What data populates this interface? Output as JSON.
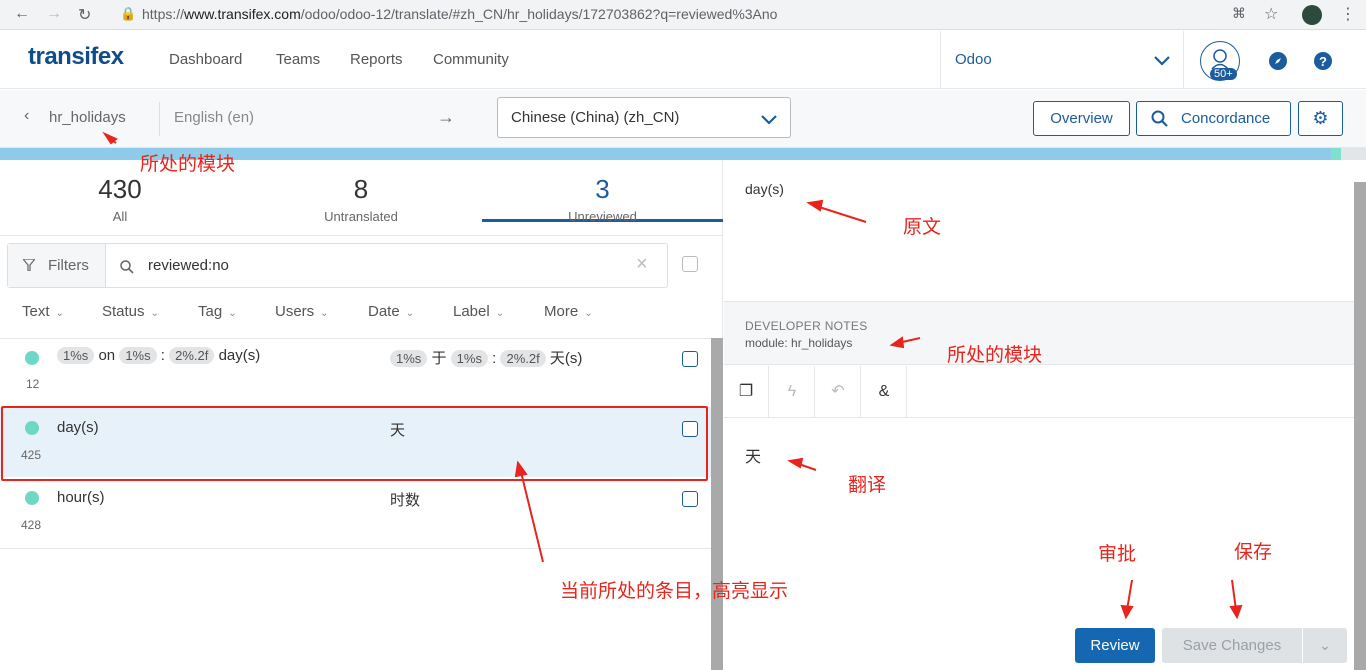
{
  "browser": {
    "url_prefix": "https://",
    "url_host": "www.transifex.com",
    "url_path": "/odoo/odoo-12/translate/#zh_CN/hr_holidays/172703862?q=reviewed%3Ano"
  },
  "topnav": {
    "logo": "transifex",
    "links": [
      "Dashboard",
      "Teams",
      "Reports",
      "Community"
    ],
    "org": "Odoo",
    "badge": "50+"
  },
  "subbar": {
    "resource": "hr_holidays",
    "source_lang": "English (en)",
    "arrow": "→",
    "target_lang": "Chinese (China) (zh_CN)",
    "overview": "Overview",
    "concordance": "Concordance"
  },
  "stats": [
    {
      "num": "430",
      "label": "All"
    },
    {
      "num": "8",
      "label": "Untranslated"
    },
    {
      "num": "3",
      "label": "Unreviewed"
    }
  ],
  "filters": {
    "button": "Filters",
    "query": "reviewed:no"
  },
  "columns": [
    "Text",
    "Status",
    "Tag",
    "Users",
    "Date",
    "Label",
    "More"
  ],
  "rows": [
    {
      "id": "12",
      "src_tokens": [
        "1%s",
        "on",
        "1%s",
        ":",
        "2%.2f",
        "day(s)"
      ],
      "trg_tokens": [
        "1%s",
        "于",
        "1%s",
        ":",
        "2%.2f",
        "天(s)"
      ]
    },
    {
      "id": "425",
      "source": "day(s)",
      "translation": "天"
    },
    {
      "id": "428",
      "source": "hour(s)",
      "translation": "时数"
    }
  ],
  "detail": {
    "source": "day(s)",
    "notes_title": "DEVELOPER NOTES",
    "notes_body": "module: hr_holidays",
    "translation": "天",
    "review": "Review",
    "save": "Save Changes"
  },
  "annotations": {
    "module1": "所处的模块",
    "original": "原文",
    "module2": "所处的模块",
    "translation": "翻译",
    "approve": "审批",
    "save": "保存",
    "current": "当前所处的条目，高亮显示"
  },
  "colors": {
    "brand": "#0f4c8a",
    "accent": "#1a5c9e",
    "annotation": "#e8251d",
    "highlight": "#e7f1f9",
    "status_dot": "#6ed8c4"
  }
}
